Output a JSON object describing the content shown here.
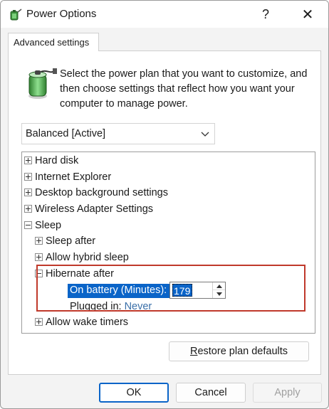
{
  "window": {
    "title": "Power Options",
    "help_label": "?",
    "close_label": "✕"
  },
  "tab": {
    "label": "Advanced settings"
  },
  "description": "Select the power plan that you want to customize, and then choose settings that reflect how you want your computer to manage power.",
  "plan_select": {
    "value": "Balanced [Active]"
  },
  "tree": {
    "items": [
      {
        "label": "Hard disk",
        "state": "collapsed"
      },
      {
        "label": "Internet Explorer",
        "state": "collapsed"
      },
      {
        "label": "Desktop background settings",
        "state": "collapsed"
      },
      {
        "label": "Wireless Adapter Settings",
        "state": "collapsed"
      },
      {
        "label": "Sleep",
        "state": "expanded"
      },
      {
        "label": "Sleep after",
        "state": "collapsed"
      },
      {
        "label": "Allow hybrid sleep",
        "state": "collapsed"
      },
      {
        "label": "Hibernate after",
        "state": "expanded"
      },
      {
        "label": "Allow wake timers",
        "state": "collapsed"
      }
    ],
    "hibernate": {
      "battery_label": "On battery (Minutes):",
      "battery_value": "179",
      "plugged_label": "Plugged in:",
      "plugged_value": "Never"
    }
  },
  "buttons": {
    "restore_first": "R",
    "restore_rest": "estore plan defaults",
    "ok": "OK",
    "cancel": "Cancel",
    "apply": "Apply"
  },
  "colors": {
    "accent": "#0a64c8",
    "highlight_border": "#c0392b",
    "link_value": "#3a6fa8"
  }
}
